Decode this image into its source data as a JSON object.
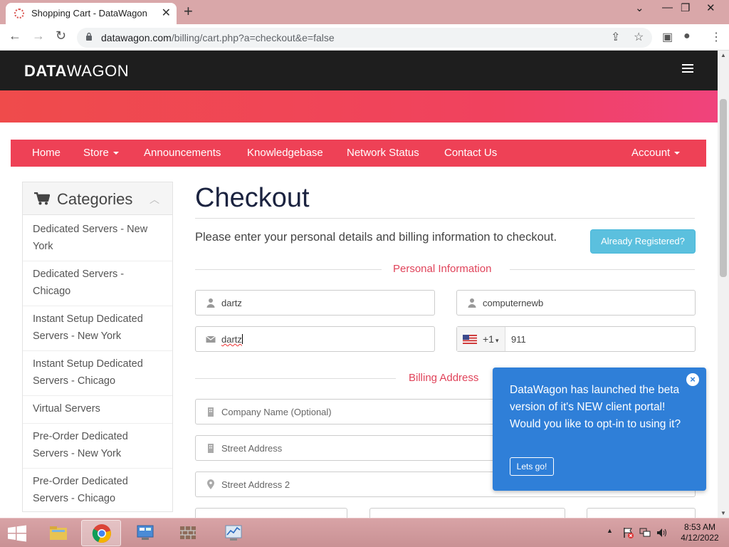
{
  "browser": {
    "tab_title": "Shopping Cart - DataWagon",
    "url_domain": "datawagon.com",
    "url_path": "/billing/cart.php?a=checkout&e=false"
  },
  "site": {
    "logo_bold": "DATA",
    "logo_regular": "WAGON",
    "nav": {
      "home": "Home",
      "store": "Store",
      "announcements": "Announcements",
      "knowledgebase": "Knowledgebase",
      "network_status": "Network Status",
      "contact_us": "Contact Us",
      "account": "Account"
    }
  },
  "sidebar": {
    "title": "Categories",
    "items": [
      {
        "label": "Dedicated Servers - New York"
      },
      {
        "label": "Dedicated Servers - Chicago"
      },
      {
        "label": "Instant Setup Dedicated Servers - New York"
      },
      {
        "label": "Instant Setup Dedicated Servers - Chicago"
      },
      {
        "label": "Virtual Servers"
      },
      {
        "label": "Pre-Order Dedicated Servers - New York"
      },
      {
        "label": "Pre-Order Dedicated Servers - Chicago"
      }
    ]
  },
  "checkout": {
    "title": "Checkout",
    "intro": "Please enter your personal details and billing information to checkout.",
    "already_registered": "Already Registered?",
    "personal_section": "Personal Information",
    "billing_section": "Billing Address",
    "first_name": "dartz",
    "last_name": "computernewb",
    "email": "dartz",
    "phone_code": "+1",
    "phone_number": "911",
    "company_placeholder": "Company Name (Optional)",
    "street_placeholder": "Street Address",
    "street2_placeholder": "Street Address 2"
  },
  "popup": {
    "message": "DataWagon has launched the beta version of it's NEW client portal! Would you like to opt-in to using it?",
    "button": "Lets go!",
    "close": "×"
  },
  "taskbar": {
    "time": "8:53 AM",
    "date": "4/12/2022"
  },
  "colors": {
    "nav_red": "#ee4156",
    "accent_red": "#e0435a",
    "info_blue": "#5bc0de",
    "popup_blue": "#2f7fd8",
    "dark_header": "#1e1e1e"
  }
}
